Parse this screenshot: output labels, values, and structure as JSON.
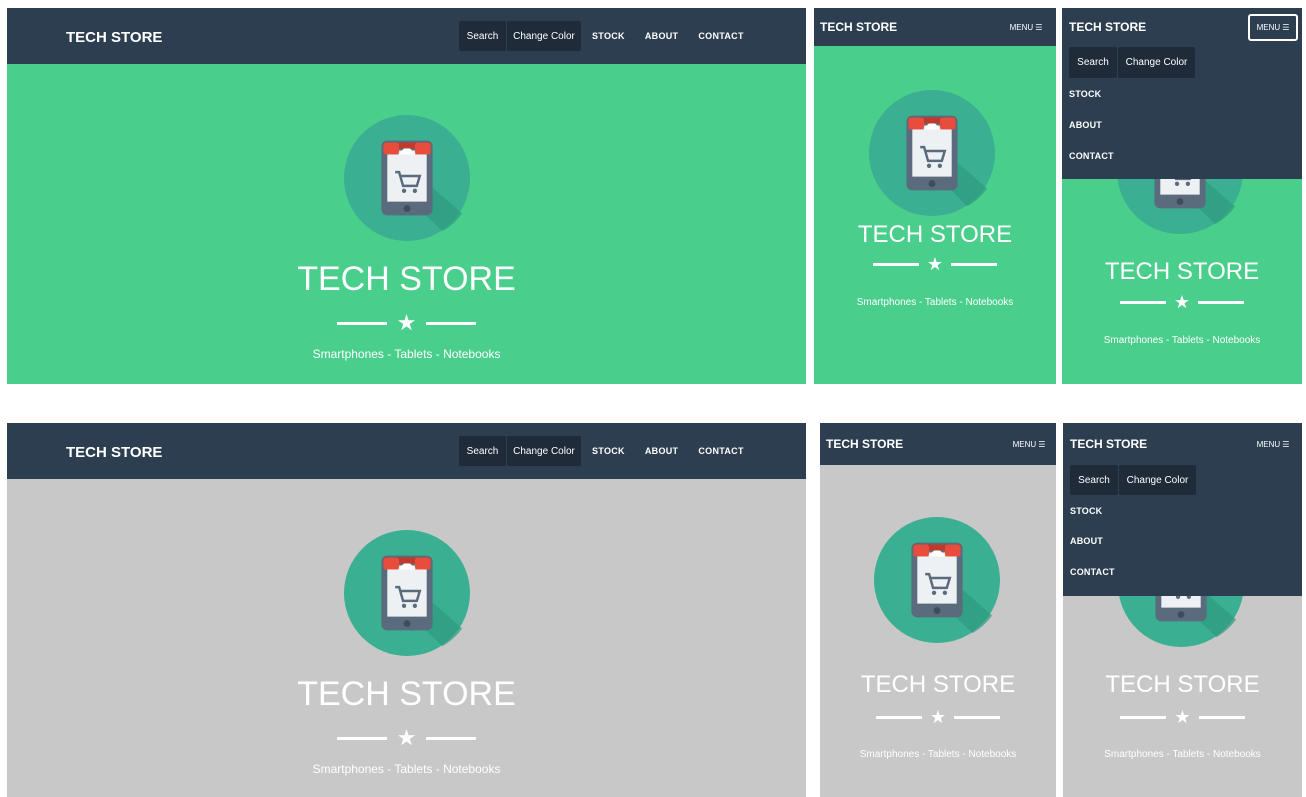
{
  "brand": "TECH STORE",
  "nav": {
    "search_label": "Search",
    "change_color_label": "Change Color",
    "stock_label": "STOCK",
    "about_label": "ABOUT",
    "contact_label": "CONTACT",
    "menu_label": "MENU"
  },
  "menu_icon": "hamburger-icon",
  "hero": {
    "title": "TECH STORE",
    "star_icon": "star-icon",
    "subtitle": "Smartphones - Tablets - Notebooks",
    "logo_icon": "shop-phone-cart-icon"
  },
  "colors": {
    "navbar": "#2c3e50",
    "nav_button": "#1f2b38",
    "hero_green": "#4ace8c",
    "hero_gray": "#c8c8c8",
    "logo_circle": "#3aaf91",
    "white": "#ffffff"
  }
}
